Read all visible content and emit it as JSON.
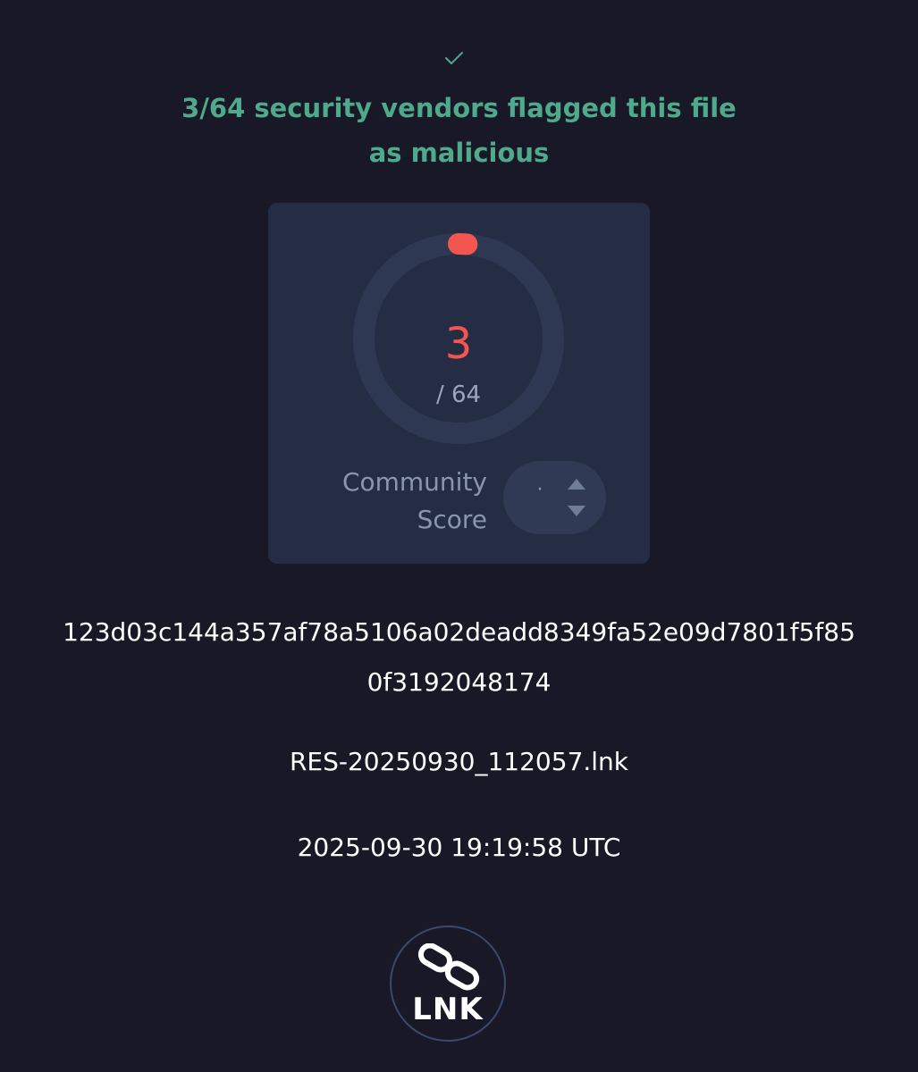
{
  "verdict": {
    "line1": "3/64 security vendors flagged this file",
    "line2": "as malicious",
    "color": "#4fa98c",
    "icon": "check-icon"
  },
  "detection": {
    "count": "3",
    "total": "/ 64",
    "detected": 3,
    "engines": 64,
    "ring_color": "#2e3852",
    "flag_color": "#f2564f"
  },
  "community": {
    "label_line1": "Community",
    "label_line2": "Score",
    "value": "·",
    "up_icon": "triangle-up-icon",
    "down_icon": "triangle-down-icon"
  },
  "file": {
    "hash_line1": "123d03c144a357af78a5106a02deadd8349fa52e09d7801f5f85",
    "hash_line2": "0f3192048174",
    "name": "RES-20250930_112057.lnk",
    "timestamp": "2025-09-30 19:19:58 UTC",
    "type_label": "LNK",
    "type_icon": "chain-link-icon"
  }
}
